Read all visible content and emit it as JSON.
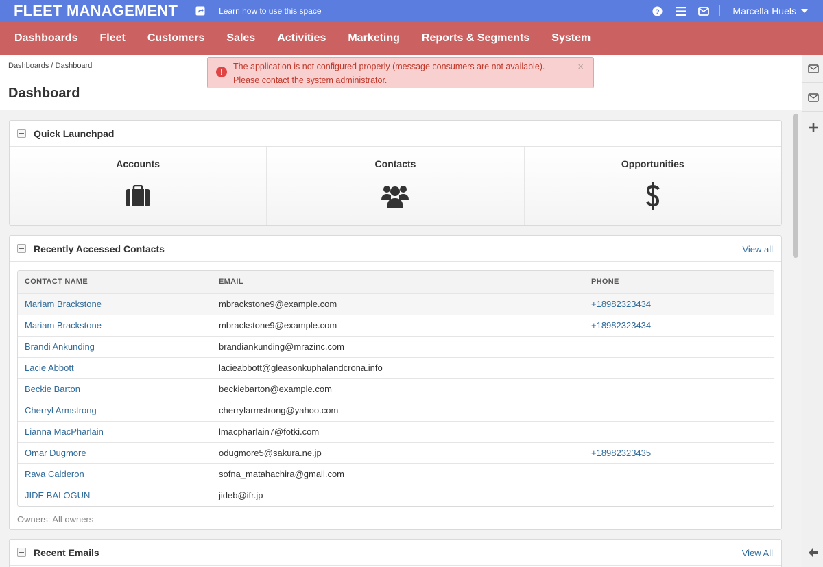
{
  "topbar": {
    "brand": "FLEET MANAGEMENT",
    "learn_link": "Learn how to use this space",
    "user_name": "Marcella Huels",
    "icons": [
      "share-icon",
      "help-icon",
      "menu-icon",
      "envelope-icon"
    ]
  },
  "nav": {
    "items": [
      "Dashboards",
      "Fleet",
      "Customers",
      "Sales",
      "Activities",
      "Marketing",
      "Reports & Segments",
      "System"
    ]
  },
  "breadcrumb": {
    "root": "Dashboards",
    "separator": "/",
    "current": "Dashboard"
  },
  "page_title": "Dashboard",
  "alert": {
    "line1": "The application is not configured properly (message consumers are not available).",
    "line2": "Please contact the system administrator.",
    "close": "×"
  },
  "quick_launchpad": {
    "title": "Quick Launchpad",
    "items": [
      {
        "label": "Accounts",
        "icon": "briefcase-icon"
      },
      {
        "label": "Contacts",
        "icon": "users-icon"
      },
      {
        "label": "Opportunities",
        "icon": "dollar-icon"
      }
    ]
  },
  "recent_contacts": {
    "title": "Recently Accessed Contacts",
    "view_all": "View all",
    "columns": [
      "CONTACT NAME",
      "EMAIL",
      "PHONE"
    ],
    "rows": [
      {
        "name": "Mariam Brackstone",
        "email": "mbrackstone9@example.com",
        "phone": "+18982323434"
      },
      {
        "name": "Mariam Brackstone",
        "email": "mbrackstone9@example.com",
        "phone": "+18982323434"
      },
      {
        "name": "Brandi Ankunding",
        "email": "brandiankunding@mrazinc.com",
        "phone": ""
      },
      {
        "name": "Lacie Abbott",
        "email": "lacieabbott@gleasonkuphalandcrona.info",
        "phone": ""
      },
      {
        "name": "Beckie Barton",
        "email": "beckiebarton@example.com",
        "phone": ""
      },
      {
        "name": "Cherryl Armstrong",
        "email": "cherrylarmstrong@yahoo.com",
        "phone": ""
      },
      {
        "name": "Lianna MacPharlain",
        "email": "lmacpharlain7@fotki.com",
        "phone": ""
      },
      {
        "name": "Omar Dugmore",
        "email": "odugmore5@sakura.ne.jp",
        "phone": "+18982323435"
      },
      {
        "name": "Rava Calderon",
        "email": "sofna_matahachira@gmail.com",
        "phone": ""
      },
      {
        "name": "JIDE BALOGUN",
        "email": "jideb@ifr.jp",
        "phone": ""
      }
    ],
    "owners": "Owners: All owners"
  },
  "recent_emails": {
    "title": "Recent Emails",
    "view_all": "View All"
  },
  "colors": {
    "topbar": "#5b7de0",
    "nav": "#cc6161",
    "link": "#2f6b9a",
    "alert_bg": "#f8d0d0",
    "alert_text": "#c0392b"
  }
}
